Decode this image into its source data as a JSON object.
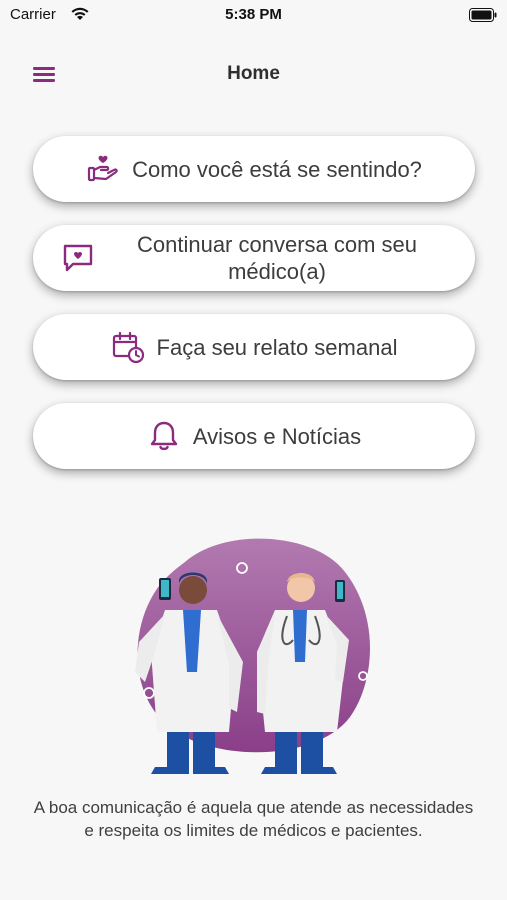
{
  "status_bar": {
    "carrier": "Carrier",
    "time": "5:38 PM"
  },
  "nav": {
    "title": "Home",
    "menu_icon": "hamburger-menu-icon"
  },
  "menu_items": [
    {
      "label": "Como você está se sentindo?",
      "icon": "hand-heart-icon"
    },
    {
      "label": "Continuar conversa com seu médico(a)",
      "icon": "chat-heart-icon"
    },
    {
      "label": "Faça seu relato semanal",
      "icon": "calendar-clock-icon"
    },
    {
      "label": "Avisos e Notícias",
      "icon": "bell-icon"
    }
  ],
  "caption": "A boa comunicação é aquela que atende as necessidades e respeita os limites de médicos e pacientes.",
  "colors": {
    "accent": "#8b2b7e",
    "background": "#f7f7f7",
    "blob": "#9b4d97"
  }
}
